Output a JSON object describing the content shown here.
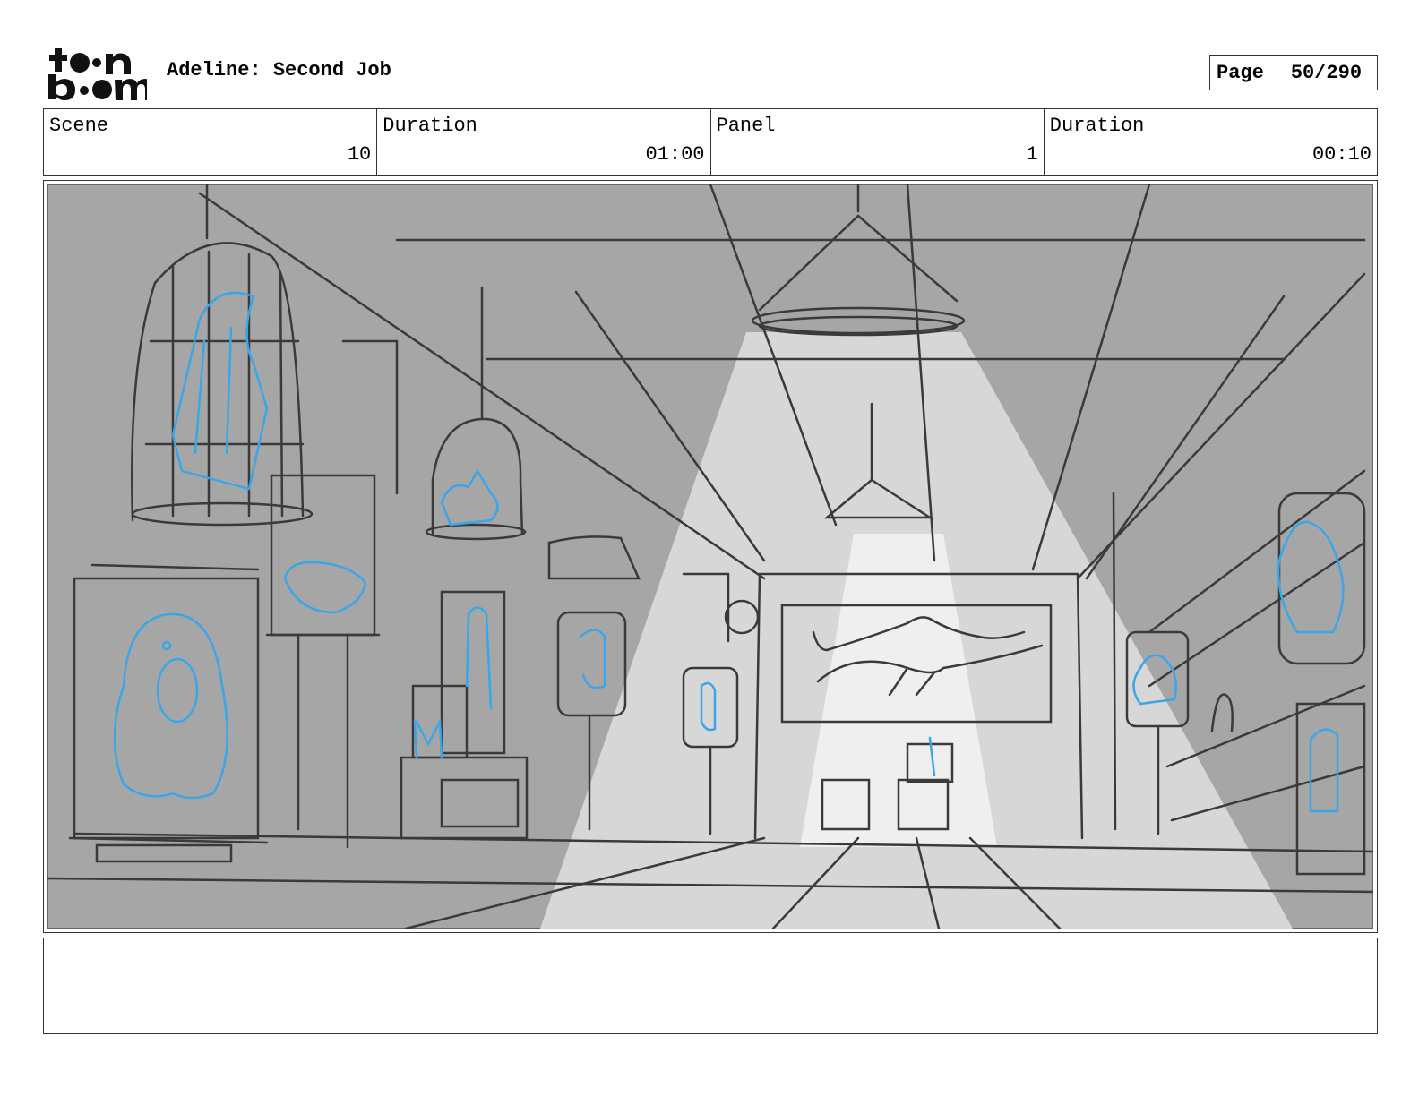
{
  "header": {
    "logo_text": "toon boom",
    "project_title": "Adeline: Second Job",
    "page_label": "Page",
    "page_number": "50/290"
  },
  "info": {
    "scene_label": "Scene",
    "scene_value": "10",
    "scene_duration_label": "Duration",
    "scene_duration_value": "01:00",
    "panel_label": "Panel",
    "panel_value": "1",
    "panel_duration_label": "Duration",
    "panel_duration_value": "00:10"
  },
  "colors": {
    "sketch_gray": "#a6a6a6",
    "light_beam": "#d9d9d9",
    "pencil": "#3a3a3a",
    "blue_sketch": "#3aa6ea"
  },
  "notes": {
    "text": ""
  }
}
